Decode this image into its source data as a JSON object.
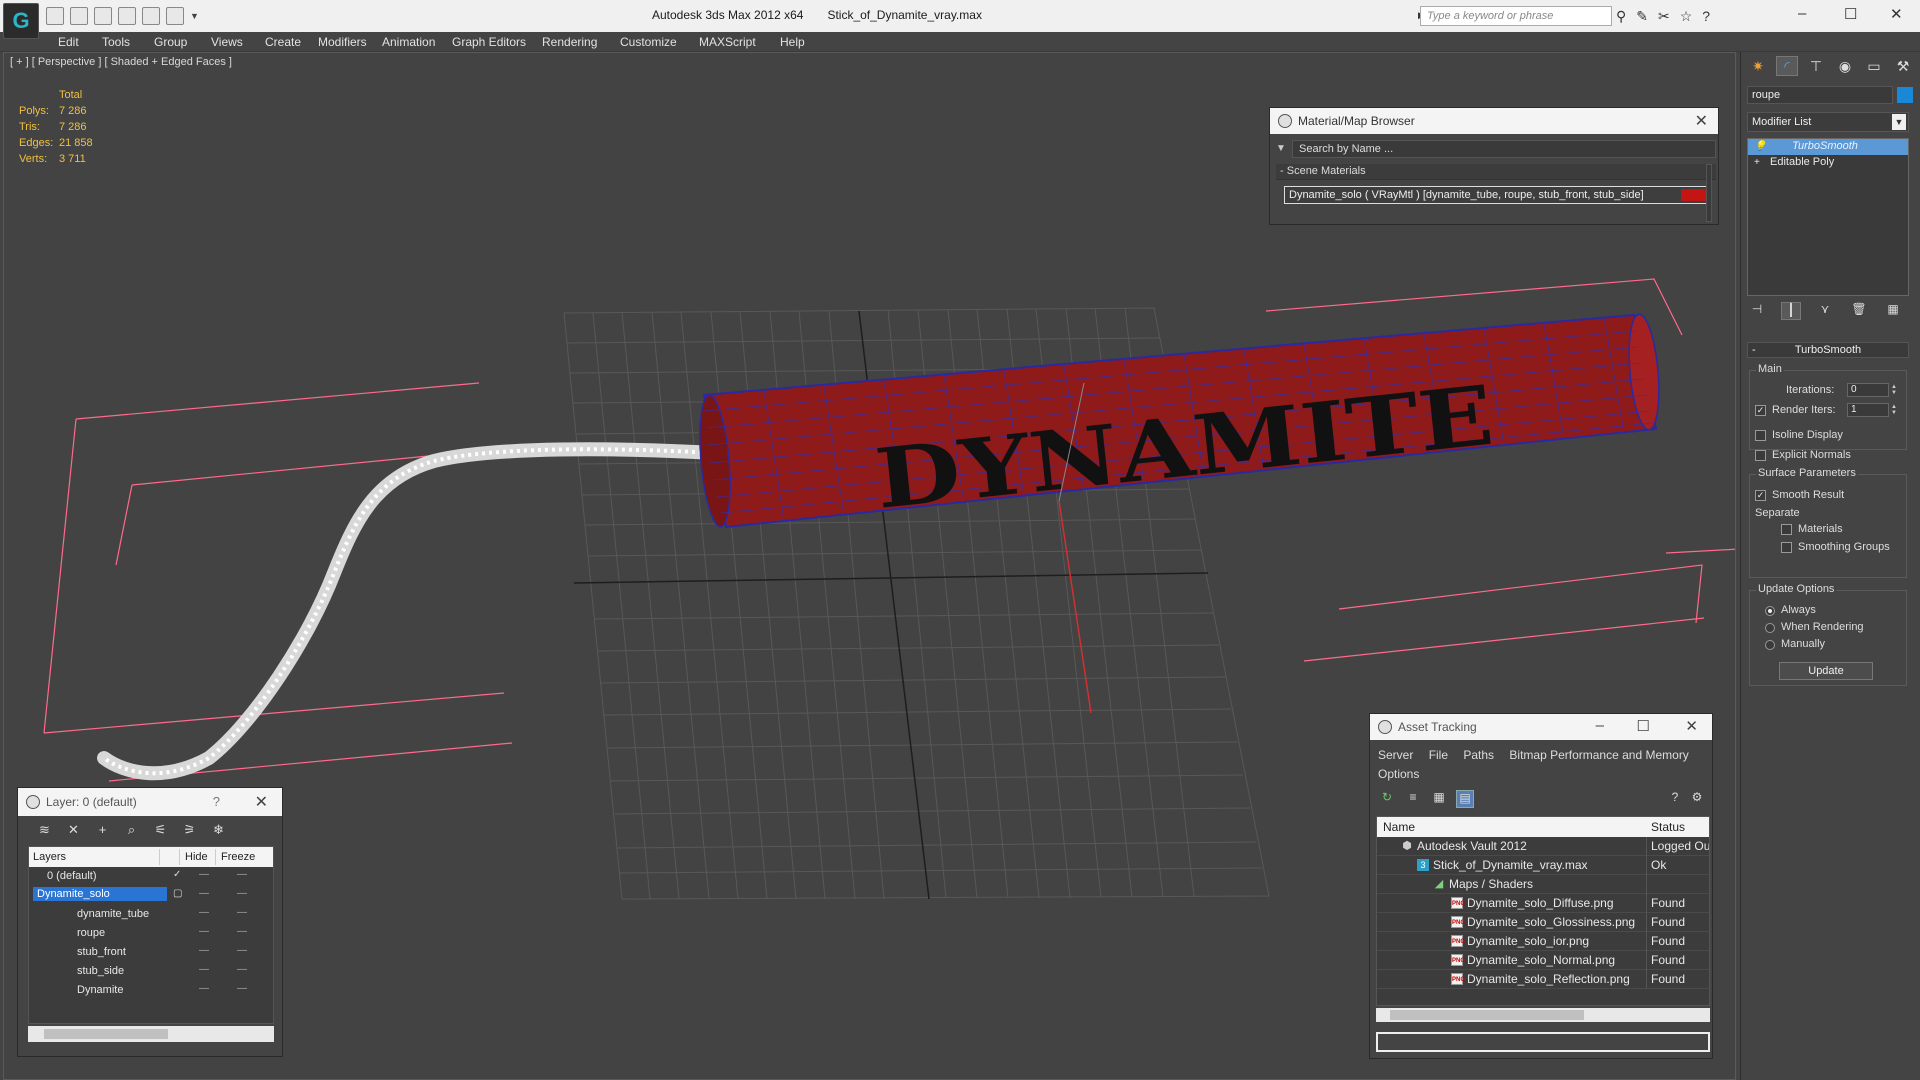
{
  "app": {
    "title": "Autodesk 3ds Max  2012 x64",
    "file": "Stick_of_Dynamite_vray.max",
    "logo_text": "G",
    "search_placeholder": "Type a keyword or phrase"
  },
  "menu": [
    "Edit",
    "Tools",
    "Group",
    "Views",
    "Create",
    "Modifiers",
    "Animation",
    "Graph Editors",
    "Rendering",
    "Customize",
    "MAXScript",
    "Help"
  ],
  "viewport": {
    "label": "[ + ] [ Perspective ] [ Shaded + Edged Faces ]",
    "stats": {
      "header": "Total",
      "rows": [
        {
          "label": "Polys:",
          "value": "7 286"
        },
        {
          "label": "Tris:",
          "value": "7 286"
        },
        {
          "label": "Edges:",
          "value": "21 858"
        },
        {
          "label": "Verts:",
          "value": "3 711"
        }
      ]
    },
    "object_text": "DYNAMITE"
  },
  "material_browser": {
    "title": "Material/Map Browser",
    "search": "Search by Name ...",
    "section": "Scene Materials",
    "material": "Dynamite_solo  ( VRayMtl ) [dynamite_tube, roupe, stub_front, stub_side]",
    "swatch_color": "#c41414"
  },
  "command_panel": {
    "object_name": "roupe",
    "object_color": "#1a88d6",
    "modifier_list": "Modifier List",
    "stack": [
      "TurboSmooth",
      "Editable Poly"
    ],
    "rollout": "TurboSmooth",
    "main_label": "Main",
    "iterations_label": "Iterations:",
    "iterations_value": "0",
    "render_iters_label": "Render Iters:",
    "render_iters_value": "1",
    "isoline": "Isoline Display",
    "explicit": "Explicit Normals",
    "surface_label": "Surface Parameters",
    "smooth_result": "Smooth Result",
    "separate": "Separate",
    "materials": "Materials",
    "smoothing_groups": "Smoothing Groups",
    "update_options": "Update Options",
    "always": "Always",
    "when_rendering": "When Rendering",
    "manually": "Manually",
    "update_button": "Update"
  },
  "layer_dialog": {
    "title": "Layer: 0 (default)",
    "help": "?",
    "columns": {
      "layers": "Layers",
      "hide": "Hide",
      "freeze": "Freeze"
    },
    "rows": [
      {
        "name": "0 (default)",
        "indent": 0,
        "selected": false,
        "check": "✓"
      },
      {
        "name": "Dynamite_solo",
        "indent": 0,
        "selected": true,
        "check": "▢"
      },
      {
        "name": "dynamite_tube",
        "indent": 1,
        "selected": false,
        "check": ""
      },
      {
        "name": "roupe",
        "indent": 1,
        "selected": false,
        "check": ""
      },
      {
        "name": "stub_front",
        "indent": 1,
        "selected": false,
        "check": ""
      },
      {
        "name": "stub_side",
        "indent": 1,
        "selected": false,
        "check": ""
      },
      {
        "name": "Dynamite",
        "indent": 1,
        "selected": false,
        "check": ""
      }
    ]
  },
  "asset_tracking": {
    "title": "Asset Tracking",
    "menu": [
      "Server",
      "File",
      "Paths",
      "Bitmap Performance and Memory",
      "Options"
    ],
    "columns": {
      "name": "Name",
      "status": "Status"
    },
    "rows": [
      {
        "name": "Autodesk Vault 2012",
        "status": "Logged Ou",
        "icon": "vault",
        "indent": 0
      },
      {
        "name": "Stick_of_Dynamite_vray.max",
        "status": "Ok",
        "icon": "max",
        "indent": 1
      },
      {
        "name": "Maps / Shaders",
        "status": "",
        "icon": "fold",
        "indent": 2
      },
      {
        "name": "Dynamite_solo_Diffuse.png",
        "status": "Found",
        "icon": "png",
        "indent": 3
      },
      {
        "name": "Dynamite_solo_Glossiness.png",
        "status": "Found",
        "icon": "png",
        "indent": 3
      },
      {
        "name": "Dynamite_solo_ior.png",
        "status": "Found",
        "icon": "png",
        "indent": 3
      },
      {
        "name": "Dynamite_solo_Normal.png",
        "status": "Found",
        "icon": "png",
        "indent": 3
      },
      {
        "name": "Dynamite_solo_Reflection.png",
        "status": "Found",
        "icon": "png",
        "indent": 3
      }
    ]
  }
}
